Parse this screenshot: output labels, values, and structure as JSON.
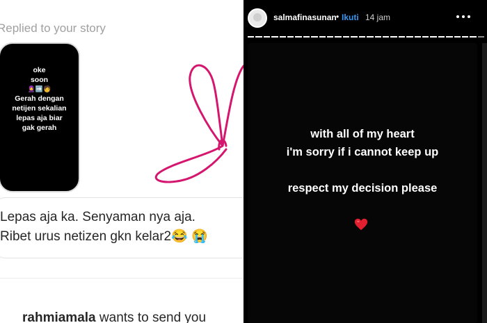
{
  "dm": {
    "replied_label": "Replied to your story",
    "story_preview": {
      "line1": "oke",
      "line2": "soon",
      "line3": "Gerah dengan",
      "line4": "netijen sekalian",
      "line5": "lepas aja biar",
      "line6": "gak gerah"
    },
    "message_line1": "Lepas aja ka. Senyaman nya aja.",
    "message_line2": "Ribet urus netizen gkn kelar2",
    "emoji_laugh": "😂",
    "emoji_cry": "😭",
    "request_user": "rahmiamala",
    "request_text": " wants to send you"
  },
  "story": {
    "username": "salmafinasunan",
    "separator": "•",
    "follow_label": "Ikuti",
    "time": "14 jam",
    "segments_total": 30,
    "segments_done": 29,
    "text_line1": "with all of my heart",
    "text_line2": "i'm sorry if i cannot keep up",
    "text_line3": "respect my decision please",
    "accent_heart": "#e0202e",
    "doodle_color": "#d4166f",
    "follow_color": "#3897f0"
  }
}
